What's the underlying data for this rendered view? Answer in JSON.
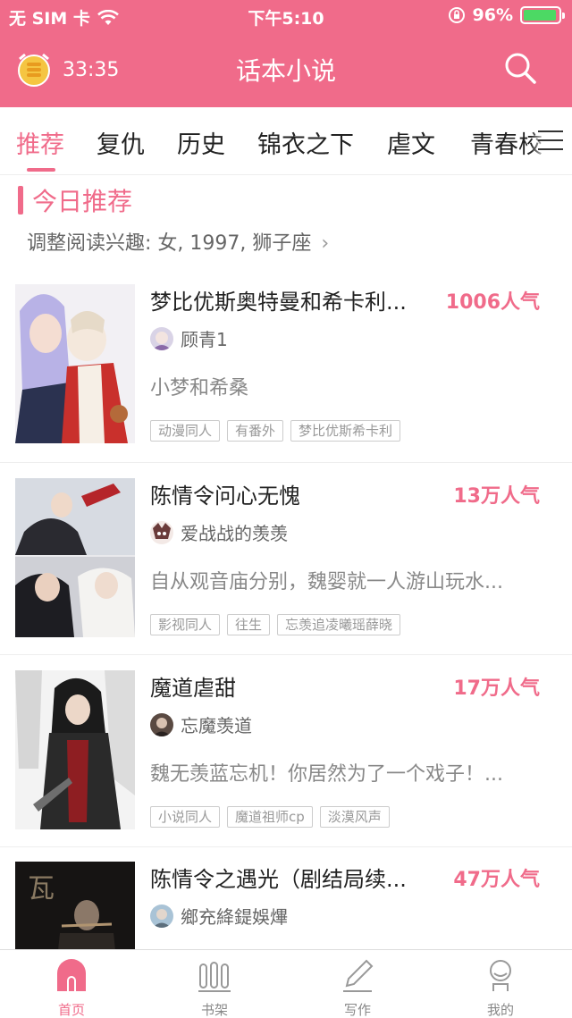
{
  "status_bar": {
    "carrier": "无 SIM 卡",
    "time": "下午5:10",
    "battery": "96%",
    "battery_level": 0.96
  },
  "header": {
    "timer": "33:35",
    "title": "话本小说",
    "accent_color": "#f06b8a"
  },
  "categories": [
    {
      "label": "推荐",
      "active": true
    },
    {
      "label": "复仇"
    },
    {
      "label": "历史"
    },
    {
      "label": "锦衣之下"
    },
    {
      "label": "虐文"
    },
    {
      "label": "青春校"
    }
  ],
  "section": {
    "title": "今日推荐",
    "interest": "调整阅读兴趣: 女, 1997, 狮子座"
  },
  "books": [
    {
      "title": "梦比优斯奥特曼和希卡利...",
      "popularity": "1006人气",
      "author": "顾青1",
      "desc": "小梦和希桑",
      "tags": [
        "动漫同人",
        "有番外",
        "梦比优斯希卡利"
      ]
    },
    {
      "title": "陈情令问心无愧",
      "popularity": "13万人气",
      "author": "爱战战的羡羡",
      "desc": "自从观音庙分别，魏婴就一人游山玩水...",
      "tags": [
        "影视同人",
        "往生",
        "忘羡追凌曦瑶薛晓"
      ]
    },
    {
      "title": "魔道虐甜",
      "popularity": "17万人气",
      "author": "忘魔羡道",
      "desc": "魏无羡蓝忘机！你居然为了一个戏子！...",
      "tags": [
        "小说同人",
        "魔道祖师cp",
        "淡漠风声"
      ]
    },
    {
      "title": "陈情令之遇光（剧结局续...",
      "popularity": "47万人气",
      "author": "鄉充絳鍉娛熚"
    }
  ],
  "tabbar": [
    {
      "label": "首页",
      "icon": "home-icon",
      "active": true
    },
    {
      "label": "书架",
      "icon": "bookshelf-icon"
    },
    {
      "label": "写作",
      "icon": "pen-icon"
    },
    {
      "label": "我的",
      "icon": "profile-icon"
    }
  ]
}
